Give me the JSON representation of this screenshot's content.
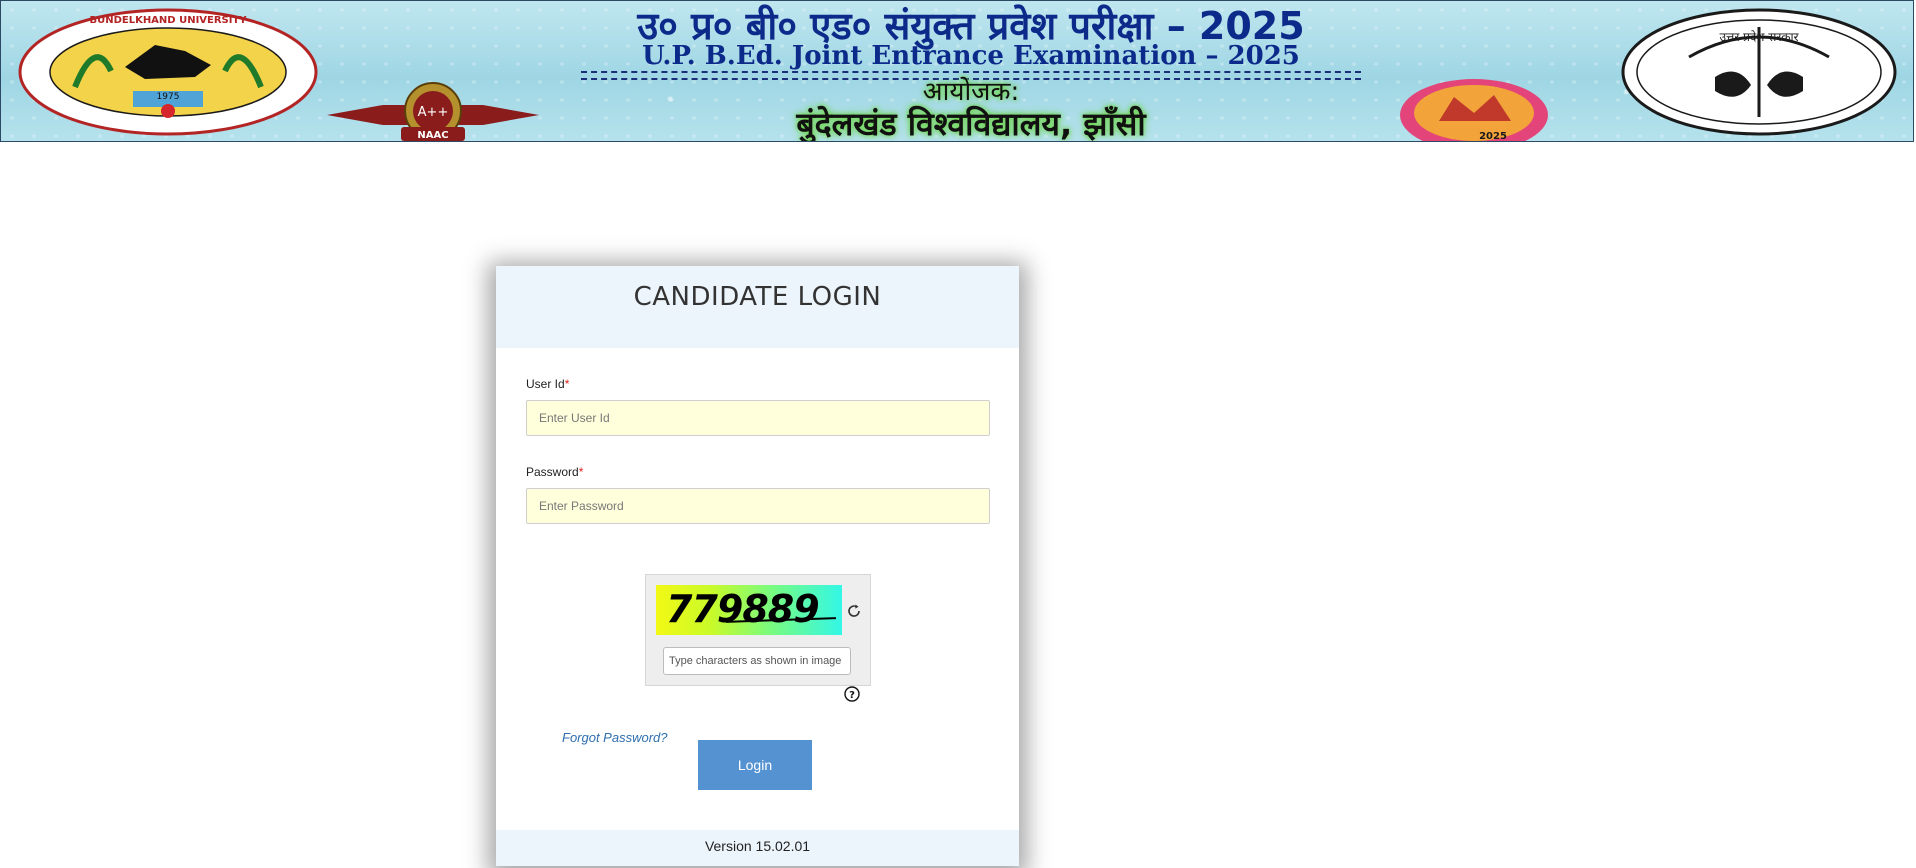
{
  "banner": {
    "title_hindi": "उ० प्र० बी० एड० संयुक्त प्रवेश परीक्षा – 2025",
    "title_english": "U.P. B.Ed. Joint Entrance Examination – 2025",
    "organiser_label": "आयोजक:",
    "university_name": "बुंदेलखंड विश्वविद्यालय, झाँसी",
    "left_logo": {
      "icon": "university-seal-icon",
      "text_top": "BUNDELKHAND UNIVERSITY",
      "year": "1975"
    },
    "naac_badge": {
      "icon": "naac-badge-icon",
      "grade": "A++",
      "label": "NAAC"
    },
    "event_badge": {
      "icon": "event-badge-icon",
      "year": "2025"
    },
    "right_logo": {
      "icon": "up-government-emblem-icon",
      "text": "उत्तर प्रदेश सरकार"
    }
  },
  "login": {
    "title": "CANDIDATE LOGIN",
    "user_id_label": "User Id",
    "user_id_placeholder": "Enter User Id",
    "password_label": "Password",
    "password_placeholder": "Enter Password",
    "required_mark": "*",
    "captcha_text": "779889",
    "captcha_placeholder": "Type characters as shown in image",
    "forgot_password": "Forgot Password?",
    "login_button": "Login",
    "version": "Version 15.02.01"
  },
  "colors": {
    "header_bg": "#edf5fc",
    "input_bg": "#ffffdc",
    "button_bg": "#5592d1",
    "link": "#2f6fb0",
    "required": "#e02020",
    "banner_text": "#0c2a8a"
  }
}
